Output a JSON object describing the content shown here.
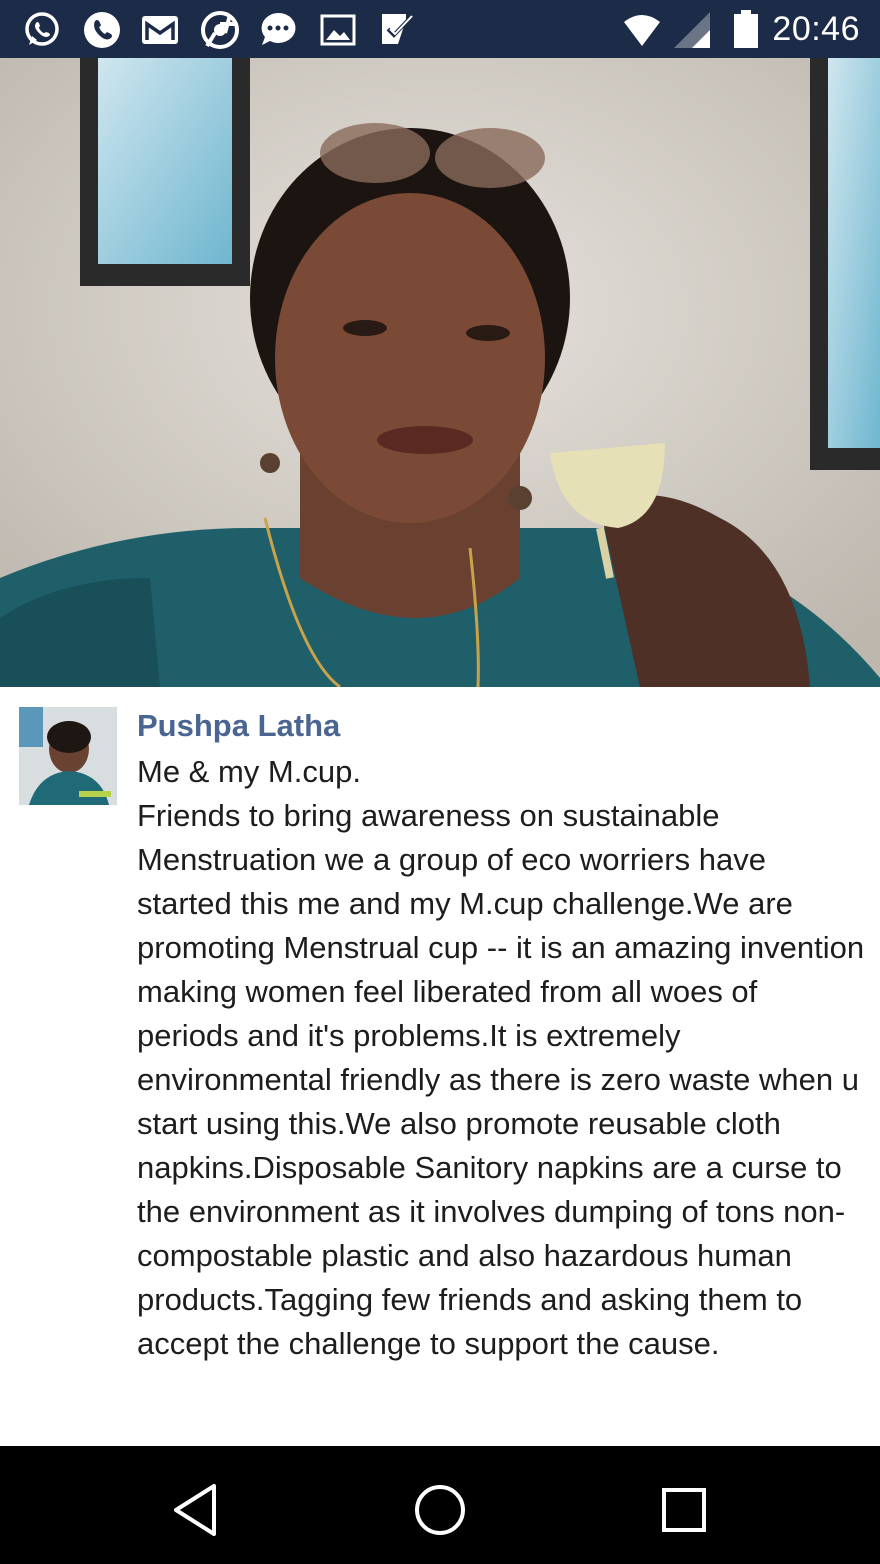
{
  "status_bar": {
    "time": "20:46",
    "left_icons": [
      "whatsapp-icon",
      "phone-icon",
      "gmail-icon",
      "chrome-icon",
      "messaging-icon",
      "gallery-icon",
      "task-check-icon"
    ],
    "right_icons": [
      "wifi-icon",
      "signal-icon",
      "battery-icon"
    ]
  },
  "post": {
    "author": "Pushpa Latha",
    "text": "Me & my M.cup.\nFriends to bring awareness on sustainable Menstruation we a group of eco worriers have started this me and my M.cup challenge.We are promoting Menstrual cup -- it is an amazing invention making women feel liberated from all woes of periods and it's problems.It is extremely environmental friendly as there is zero waste when u start using this.We also promote reusable cloth napkins.Disposable Sanitory napkins are a curse to the environment as it involves dumping of tons non-compostable plastic and also hazardous human products.Tagging few friends and asking them to accept the challenge to support the cause."
  },
  "nav_bar": {
    "buttons": [
      "back-icon",
      "home-icon",
      "recents-icon"
    ]
  }
}
